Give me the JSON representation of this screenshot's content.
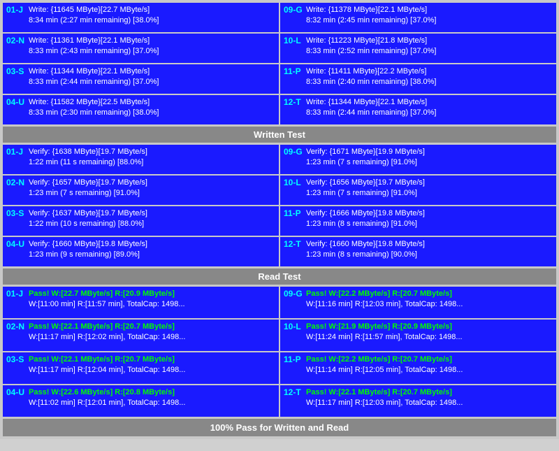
{
  "sections": {
    "write_test": {
      "label": "Written Test",
      "rows_left": [
        {
          "id": "01-J",
          "line1": "Write: {11645 MByte}[22.7 MByte/s]",
          "line2": "8:34 min (2:27 min remaining)  [38.0%]"
        },
        {
          "id": "02-N",
          "line1": "Write: {11361 MByte}[22.1 MByte/s]",
          "line2": "8:33 min (2:43 min remaining)  [37.0%]"
        },
        {
          "id": "03-S",
          "line1": "Write: {11344 MByte}[22.1 MByte/s]",
          "line2": "8:33 min (2:44 min remaining)  [37.0%]"
        },
        {
          "id": "04-U",
          "line1": "Write: {11582 MByte}[22.5 MByte/s]",
          "line2": "8:33 min (2:30 min remaining)  [38.0%]"
        }
      ],
      "rows_right": [
        {
          "id": "09-G",
          "line1": "Write: {11378 MByte}[22.1 MByte/s]",
          "line2": "8:32 min (2:45 min remaining)  [37.0%]"
        },
        {
          "id": "10-L",
          "line1": "Write: {11223 MByte}[21.8 MByte/s]",
          "line2": "8:33 min (2:52 min remaining)  [37.0%]"
        },
        {
          "id": "11-P",
          "line1": "Write: {11411 MByte}[22.2 MByte/s]",
          "line2": "8:33 min (2:40 min remaining)  [38.0%]"
        },
        {
          "id": "12-T",
          "line1": "Write: {11344 MByte}[22.1 MByte/s]",
          "line2": "8:33 min (2:44 min remaining)  [37.0%]"
        }
      ]
    },
    "verify_test": {
      "label": "Written Test",
      "rows_left": [
        {
          "id": "01-J",
          "line1": "Verify: {1638 MByte}[19.7 MByte/s]",
          "line2": "1:22 min (11 s remaining)   [88.0%]"
        },
        {
          "id": "02-N",
          "line1": "Verify: {1657 MByte}[19.7 MByte/s]",
          "line2": "1:23 min (7 s remaining)   [91.0%]"
        },
        {
          "id": "03-S",
          "line1": "Verify: {1637 MByte}[19.7 MByte/s]",
          "line2": "1:22 min (10 s remaining)   [88.0%]"
        },
        {
          "id": "04-U",
          "line1": "Verify: {1660 MByte}[19.8 MByte/s]",
          "line2": "1:23 min (9 s remaining)   [89.0%]"
        }
      ],
      "rows_right": [
        {
          "id": "09-G",
          "line1": "Verify: {1671 MByte}[19.9 MByte/s]",
          "line2": "1:23 min (7 s remaining)   [91.0%]"
        },
        {
          "id": "10-L",
          "line1": "Verify: {1656 MByte}[19.7 MByte/s]",
          "line2": "1:23 min (7 s remaining)   [91.0%]"
        },
        {
          "id": "11-P",
          "line1": "Verify: {1666 MByte}[19.8 MByte/s]",
          "line2": "1:23 min (8 s remaining)   [91.0%]"
        },
        {
          "id": "12-T",
          "line1": "Verify: {1660 MByte}[19.8 MByte/s]",
          "line2": "1:23 min (8 s remaining)   [90.0%]"
        }
      ]
    },
    "read_test": {
      "label": "Read Test",
      "rows_left": [
        {
          "id": "01-J",
          "line1": "Pass! W:[22.7 MByte/s] R:[20.9 MByte/s]",
          "line2": "W:[11:00 min] R:[11:57 min], TotalCap: 1498..."
        },
        {
          "id": "02-N",
          "line1": "Pass! W:[22.1 MByte/s] R:[20.7 MByte/s]",
          "line2": "W:[11:17 min] R:[12:02 min], TotalCap: 1498..."
        },
        {
          "id": "03-S",
          "line1": "Pass! W:[22.1 MByte/s] R:[20.7 MByte/s]",
          "line2": "W:[11:17 min] R:[12:04 min], TotalCap: 1498..."
        },
        {
          "id": "04-U",
          "line1": "Pass! W:[22.6 MByte/s] R:[20.8 MByte/s]",
          "line2": "W:[11:02 min] R:[12:01 min], TotalCap: 1498..."
        }
      ],
      "rows_right": [
        {
          "id": "09-G",
          "line1": "Pass! W:[22.2 MByte/s] R:[20.7 MByte/s]",
          "line2": "W:[11:16 min] R:[12:03 min], TotalCap: 1498..."
        },
        {
          "id": "10-L",
          "line1": "Pass! W:[21.9 MByte/s] R:[20.9 MByte/s]",
          "line2": "W:[11:24 min] R:[11:57 min], TotalCap: 1498..."
        },
        {
          "id": "11-P",
          "line1": "Pass! W:[22.2 MByte/s] R:[20.7 MByte/s]",
          "line2": "W:[11:14 min] R:[12:05 min], TotalCap: 1498..."
        },
        {
          "id": "12-T",
          "line1": "Pass! W:[22.1 MByte/s] R:[20.7 MByte/s]",
          "line2": "W:[11:17 min] R:[12:03 min], TotalCap: 1498..."
        }
      ]
    }
  },
  "headers": {
    "written_test": "Written Test",
    "read_test": "Read Test",
    "footer": "100% Pass for Written and Read"
  }
}
